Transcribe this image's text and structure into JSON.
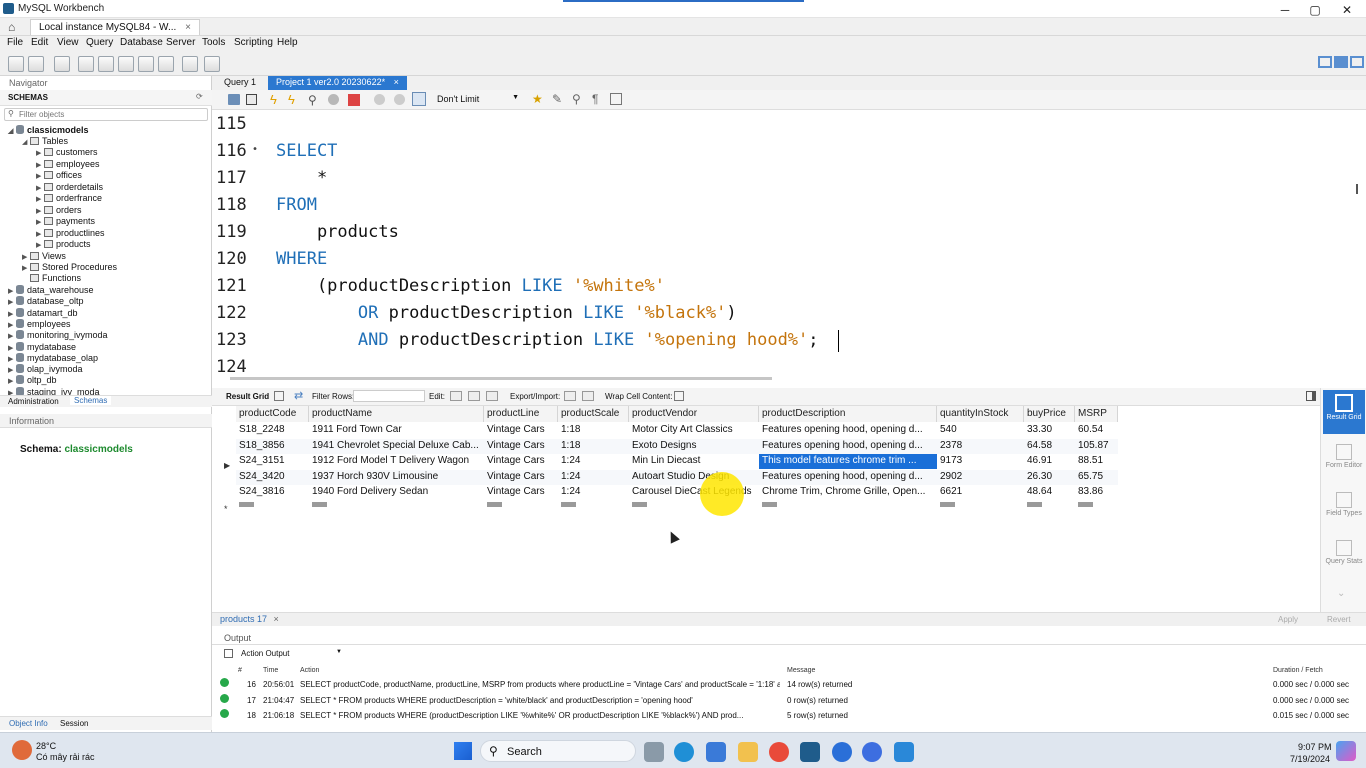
{
  "window": {
    "title": "MySQL Workbench",
    "controls": [
      "─",
      "▢",
      "✕"
    ]
  },
  "doc_tab": "Local instance MySQL84 - W...",
  "menu": [
    "File",
    "Edit",
    "View",
    "Query",
    "Database",
    "Server",
    "Tools",
    "Scripting",
    "Help"
  ],
  "navigator": {
    "label": "Navigator",
    "schemas_label": "SCHEMAS",
    "filter_placeholder": "Filter objects",
    "schema": "classicmodels",
    "tables_label": "Tables",
    "tables": [
      "customers",
      "employees",
      "offices",
      "orderdetails",
      "orderfrance",
      "orders",
      "payments",
      "productlines",
      "products"
    ],
    "others": [
      "Views",
      "Stored Procedures",
      "Functions"
    ],
    "databases": [
      "data_warehouse",
      "database_oltp",
      "datamart_db",
      "employees",
      "monitoring_ivymoda",
      "mydatabase",
      "mydatabase_olap",
      "olap_ivymoda",
      "oltp_db",
      "staging_ivy_moda"
    ],
    "tabs": [
      "Administration",
      "Schemas"
    ]
  },
  "information": {
    "label": "Information",
    "schema_label": "Schema:",
    "schema_value": "classicmodels",
    "bottom_tabs": [
      "Object Info",
      "Session"
    ]
  },
  "editor_tabs": [
    "Query 1",
    "Project 1 ver2.0 20230622*"
  ],
  "limit": "Don't Limit",
  "code": {
    "lines": [
      "115",
      "116",
      "117",
      "118",
      "119",
      "120",
      "121",
      "122",
      "123",
      "124"
    ]
  },
  "grid_toolbar": {
    "result_grid": "Result Grid",
    "filter_rows": "Filter Rows:",
    "edit": "Edit:",
    "export": "Export/Import:",
    "wrap": "Wrap Cell Content:"
  },
  "grid": {
    "headers": [
      "productCode",
      "productName",
      "productLine",
      "productScale",
      "productVendor",
      "productDescription",
      "quantityInStock",
      "buyPrice",
      "MSRP"
    ],
    "rows": [
      [
        "S18_2248",
        "1911 Ford Town Car",
        "Vintage Cars",
        "1:18",
        "Motor City Art Classics",
        "Features opening hood, opening d...",
        "540",
        "33.30",
        "60.54"
      ],
      [
        "S18_3856",
        "1941 Chevrolet Special Deluxe Cab...",
        "Vintage Cars",
        "1:18",
        "Exoto Designs",
        "Features opening hood, opening d...",
        "2378",
        "64.58",
        "105.87"
      ],
      [
        "S24_3151",
        "1912 Ford Model T Delivery Wagon",
        "Vintage Cars",
        "1:24",
        "Min Lin Diecast",
        "This model features chrome trim ...",
        "9173",
        "46.91",
        "88.51"
      ],
      [
        "S24_3420",
        "1937 Horch 930V Limousine",
        "Vintage Cars",
        "1:24",
        "Autoart Studio Design",
        "Features opening hood, opening d...",
        "2902",
        "26.30",
        "65.75"
      ],
      [
        "S24_3816",
        "1940 Ford Delivery Sedan",
        "Vintage Cars",
        "1:24",
        "Carousel DieCast Legends",
        "Chrome Trim, Chrome Grille, Open...",
        "6621",
        "48.64",
        "83.86"
      ]
    ],
    "null_label": "NULL"
  },
  "right_panel": [
    "Result Grid",
    "Form Editor",
    "Field Types",
    "Query Stats"
  ],
  "result_tab": "products 17",
  "apply": "Apply",
  "revert": "Revert",
  "output": {
    "label": "Output",
    "mode": "Action Output",
    "headers": [
      "#",
      "Time",
      "Action",
      "Message",
      "Duration / Fetch"
    ],
    "rows": [
      [
        "16",
        "20:56:01",
        "SELECT productCode, productName, productLine, MSRP from products where productLine = 'Vintage Cars' and productScale = '1:18' and pr...",
        "14 row(s) returned",
        "0.000 sec / 0.000 sec"
      ],
      [
        "17",
        "21:04:47",
        "SELECT     * FROM     products WHERE  productDescription = 'white/black' and productDescription = 'opening hood'",
        "0 row(s) returned",
        "0.000 sec / 0.000 sec"
      ],
      [
        "18",
        "21:06:18",
        "SELECT     * FROM     products WHERE     (productDescription LIKE '%white%'        OR productDescription LIKE '%black%')        AND prod...",
        "5 row(s) returned",
        "0.015 sec / 0.000 sec"
      ]
    ]
  },
  "taskbar": {
    "weather_temp": "28°C",
    "weather_desc": "Có mây rải rác",
    "search": "Search",
    "time": "9:07 PM",
    "date": "7/19/2024"
  }
}
